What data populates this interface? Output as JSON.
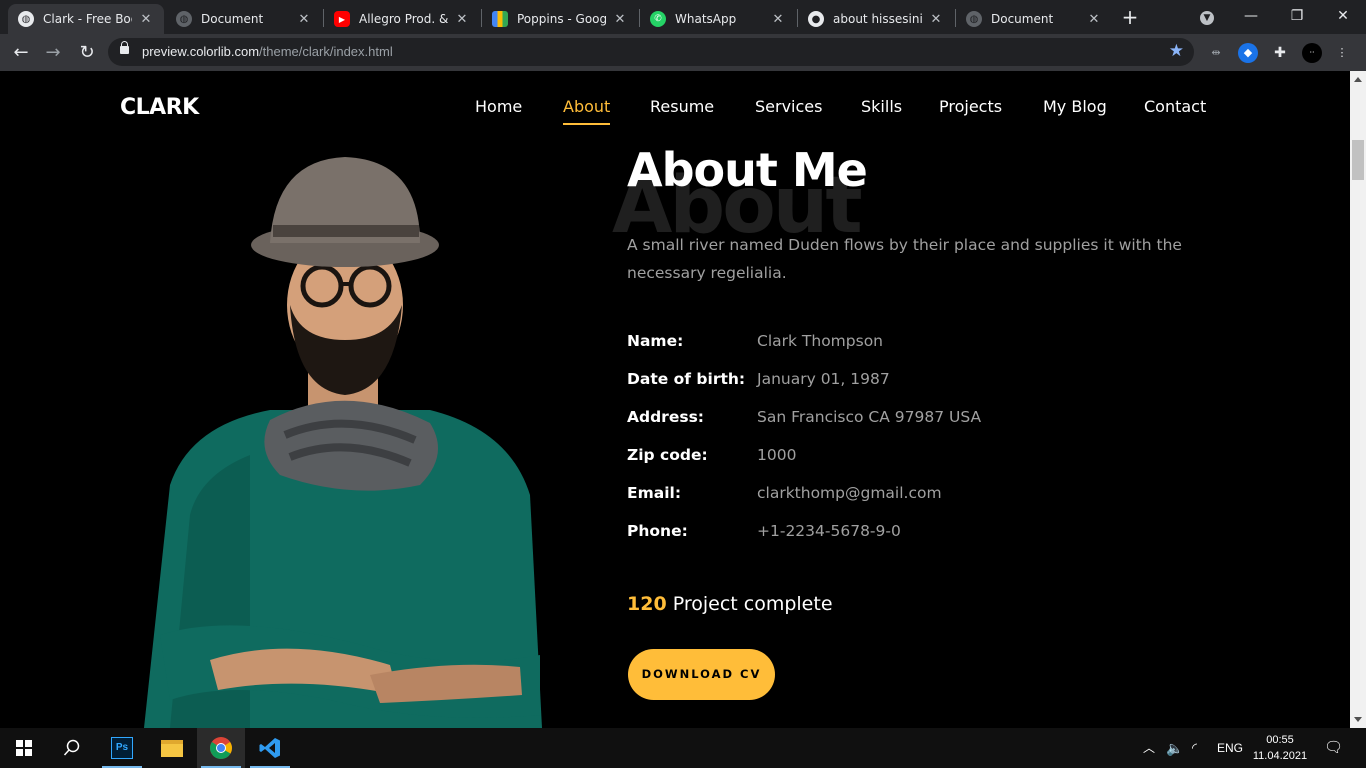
{
  "browser": {
    "tabs": [
      {
        "title": "Clark - Free Bootst",
        "active": true
      },
      {
        "title": "Document"
      },
      {
        "title": "Allegro Prod. & B"
      },
      {
        "title": "Poppins - Google"
      },
      {
        "title": "WhatsApp"
      },
      {
        "title": "about hissesini yi"
      },
      {
        "title": "Document"
      }
    ],
    "new_tab": "+",
    "url_host": "preview.colorlib.com",
    "url_path": "/theme/clark/index.html"
  },
  "site": {
    "brand": "CLARK",
    "nav": [
      "Home",
      "About",
      "Resume",
      "Services",
      "Skills",
      "Projects",
      "My Blog",
      "Contact"
    ],
    "active_nav": "About",
    "accent": "#ffbd39",
    "ghost_heading": "About",
    "heading": "About Me",
    "intro": "A small river named Duden flows by their place and supplies it with the necessary regelialia.",
    "info": [
      {
        "label": "Name:",
        "value": "Clark Thompson"
      },
      {
        "label": "Date of birth:",
        "value": "January 01, 1987"
      },
      {
        "label": "Address:",
        "value": "San Francisco CA 97987 USA"
      },
      {
        "label": "Zip code:",
        "value": "1000"
      },
      {
        "label": "Email:",
        "value": "clarkthomp@gmail.com"
      },
      {
        "label": "Phone:",
        "value": "+1-2234-5678-9-0"
      }
    ],
    "counter_value": "120",
    "counter_label": " Project complete",
    "cv_button": "DOWNLOAD CV"
  },
  "taskbar": {
    "language": "ENG",
    "time": "00:55",
    "date": "11.04.2021"
  }
}
